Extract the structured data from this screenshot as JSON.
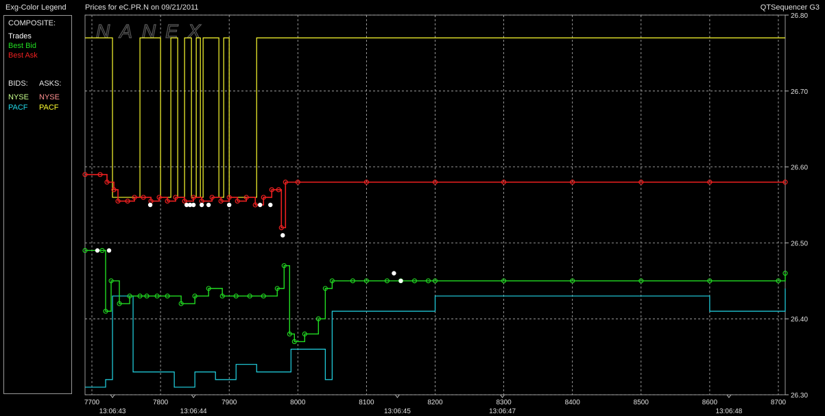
{
  "header": {
    "legend_title": "Exg-Color Legend",
    "chart_title": "Prices for  eC.PR.N  on  09/21/2011",
    "app_name": "QTSequencer G3"
  },
  "legend": {
    "composite_label": "COMPOSITE:",
    "trades": "Trades",
    "best_bid": "Best Bid",
    "best_ask": "Best Ask",
    "bids_label": "BIDS:",
    "asks_label": "ASKS:",
    "bid_nyse": "NYSE",
    "bid_pacf": "PACF",
    "ask_nyse": "NYSE",
    "ask_pacf": "PACF"
  },
  "colors": {
    "trades": "#ffffff",
    "best_bid": "#22dd22",
    "best_ask": "#ee2020",
    "nyse_bid": "#c8ff8c",
    "pacf_bid": "#22d8e8",
    "nyse_ask": "#ff9090",
    "pacf_ask": "#ffff30",
    "grid": "#bbbbbb"
  },
  "chart_data": {
    "type": "line",
    "watermark": "NANEX",
    "xlim": [
      7690,
      8710
    ],
    "ylim": [
      26.3,
      26.8
    ],
    "x_ticks": [
      7700,
      7800,
      7900,
      8000,
      8100,
      8200,
      8300,
      8400,
      8500,
      8600,
      8700
    ],
    "y_ticks": [
      "26.30",
      "26.40",
      "26.50",
      "26.60",
      "26.70",
      "26.80"
    ],
    "time_labels": [
      {
        "x": 7730,
        "label": "13:06:43"
      },
      {
        "x": 7848,
        "label": "13:06:44"
      },
      {
        "x": 8145,
        "label": "13:06:45"
      },
      {
        "x": 8298,
        "label": "13:06:47"
      },
      {
        "x": 8628,
        "label": "13:06:48"
      }
    ],
    "grid": true,
    "series": [
      {
        "key": "best_ask",
        "name": "Best Ask",
        "x": [
          7690,
          7712,
          7722,
          7732,
          7738,
          7752,
          7762,
          7775,
          7786,
          7798,
          7810,
          7822,
          7835,
          7848,
          7860,
          7875,
          7888,
          7900,
          7912,
          7925,
          7938,
          7950,
          7962,
          7972,
          7976,
          7982,
          8000,
          8100,
          8200,
          8300,
          8400,
          8500,
          8600,
          8710
        ],
        "y": [
          26.59,
          26.59,
          26.58,
          26.57,
          26.555,
          26.555,
          26.56,
          26.56,
          26.555,
          26.56,
          26.555,
          26.56,
          26.555,
          26.56,
          26.555,
          26.56,
          26.555,
          26.56,
          26.555,
          26.56,
          26.55,
          26.56,
          26.57,
          26.57,
          26.52,
          26.58,
          26.58,
          26.58,
          26.58,
          26.58,
          26.58,
          26.58,
          26.58,
          26.58
        ]
      },
      {
        "key": "pacf_ask",
        "name": "PACF",
        "x": [
          7690,
          7718,
          7730,
          7770,
          7800,
          7815,
          7825,
          7835,
          7845,
          7852,
          7858,
          7862,
          7885,
          7892,
          7900,
          7935,
          7940,
          7965,
          7975,
          7978,
          8000,
          8100,
          8200,
          8300,
          8400,
          8500,
          8600,
          8710
        ],
        "y": [
          26.77,
          26.77,
          26.56,
          26.77,
          26.56,
          26.77,
          26.56,
          26.77,
          26.56,
          26.77,
          26.56,
          26.77,
          26.56,
          26.77,
          26.56,
          26.56,
          26.77,
          26.77,
          26.77,
          26.77,
          26.77,
          26.77,
          26.77,
          26.77,
          26.77,
          26.77,
          26.77,
          26.77
        ]
      },
      {
        "key": "best_bid",
        "name": "Best Bid",
        "x": [
          7690,
          7715,
          7720,
          7728,
          7740,
          7755,
          7770,
          7780,
          7795,
          7810,
          7830,
          7850,
          7870,
          7890,
          7910,
          7930,
          7950,
          7970,
          7980,
          7988,
          7995,
          8010,
          8030,
          8040,
          8050,
          8080,
          8100,
          8130,
          8150,
          8170,
          8190,
          8200,
          8300,
          8400,
          8500,
          8600,
          8700,
          8710
        ],
        "y": [
          26.49,
          26.49,
          26.41,
          26.45,
          26.42,
          26.43,
          26.43,
          26.43,
          26.43,
          26.43,
          26.42,
          26.43,
          26.44,
          26.43,
          26.43,
          26.43,
          26.43,
          26.44,
          26.47,
          26.38,
          26.37,
          26.38,
          26.4,
          26.44,
          26.45,
          26.45,
          26.45,
          26.45,
          26.45,
          26.45,
          26.45,
          26.45,
          26.45,
          26.45,
          26.45,
          26.45,
          26.45,
          26.46
        ]
      },
      {
        "key": "pacf_bid",
        "name": "PACF",
        "x": [
          7690,
          7720,
          7730,
          7760,
          7790,
          7820,
          7850,
          7880,
          7910,
          7940,
          7970,
          7990,
          8010,
          8040,
          8050,
          8100,
          8150,
          8200,
          8300,
          8400,
          8500,
          8600,
          8710
        ],
        "y": [
          26.31,
          26.32,
          26.43,
          26.33,
          26.33,
          26.31,
          26.33,
          26.32,
          26.34,
          26.33,
          26.33,
          26.36,
          26.36,
          26.32,
          26.41,
          26.41,
          26.41,
          26.43,
          26.43,
          26.43,
          26.43,
          26.41,
          26.44
        ]
      },
      {
        "key": "trades",
        "name": "Trades",
        "x": [
          7708,
          7725,
          7785,
          7838,
          7843,
          7848,
          7860,
          7870,
          7900,
          7945,
          7960,
          7978,
          8140,
          8150
        ],
        "y": [
          26.49,
          26.49,
          26.55,
          26.55,
          26.55,
          26.55,
          26.55,
          26.55,
          26.55,
          26.55,
          26.55,
          26.51,
          26.46,
          26.45
        ]
      }
    ]
  }
}
